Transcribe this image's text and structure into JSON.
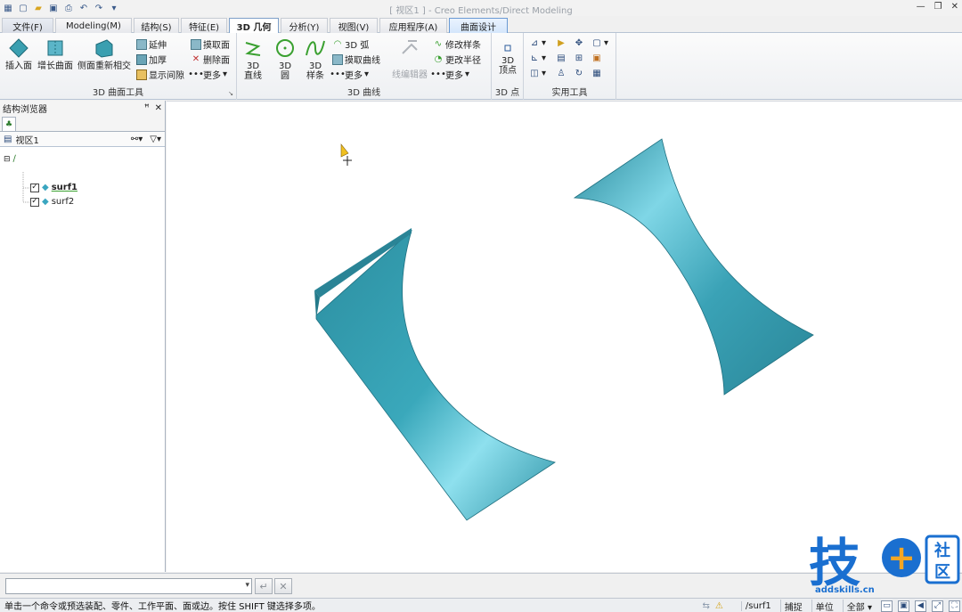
{
  "window": {
    "title": "[ 视区1 ] - Creo Elements/Direct Modeling"
  },
  "tabs": [
    {
      "label": "文件(F)"
    },
    {
      "label": "Modeling(M)"
    },
    {
      "label": "结构(S)"
    },
    {
      "label": "特征(E)"
    },
    {
      "label": "3D 几何"
    },
    {
      "label": "分析(Y)"
    },
    {
      "label": "视图(V)"
    },
    {
      "label": "应用程序(A)"
    },
    {
      "label": "曲面设计"
    }
  ],
  "ribbon": {
    "surface_group": {
      "label": "3D 曲面工具",
      "insert_face": "插入面",
      "grow_surface": "增长曲面",
      "side_reintersect": "侧面重新相交",
      "extend": "延伸",
      "thicken": "加厚",
      "show_gap": "显示间隙",
      "extract_face": "摸取面",
      "delete_face": "删除面",
      "more": "更多"
    },
    "curve_group": {
      "label": "3D 曲线",
      "line_top": "3D",
      "line_bottom": "直线",
      "circle_top": "3D",
      "circle_bottom": "圆",
      "spline_top": "3D",
      "spline_bottom": "样条",
      "arc": "3D 弧",
      "extract_curve": "摸取曲线",
      "more": "更多",
      "wire_edit": "线编辑器",
      "modify_spline": "修改样条",
      "change_radius": "更改半径",
      "more2": "更多"
    },
    "point_group": {
      "label": "3D 点",
      "vertex_top": "3D",
      "vertex_bottom": "顶点"
    },
    "utility_group": {
      "label": "实用工具"
    }
  },
  "browser": {
    "title": "结构浏览器",
    "viewport": "视区1",
    "items": [
      {
        "label": "surf1",
        "checked": true
      },
      {
        "label": "surf2",
        "checked": true
      }
    ]
  },
  "command": {
    "value": "",
    "enter_icon": "enter-icon",
    "cancel_icon": "close-icon"
  },
  "status": {
    "message": "单击一个命令或预选装配、零件、工作平面、面或边。按住 SHIFT 键选择多项。",
    "current": "/surf1",
    "snap": "捕捉",
    "unit": "单位",
    "scope": "全部"
  },
  "watermark": {
    "text": "技",
    "plus": "+",
    "badge_top": "社",
    "badge_bottom": "区",
    "url": "addskills.cn"
  },
  "colors": {
    "surface": "#2a8a9c",
    "surface_highlight": "#7fd6e6",
    "accent": "#1a6fd0",
    "logo_orange": "#f5a623"
  }
}
